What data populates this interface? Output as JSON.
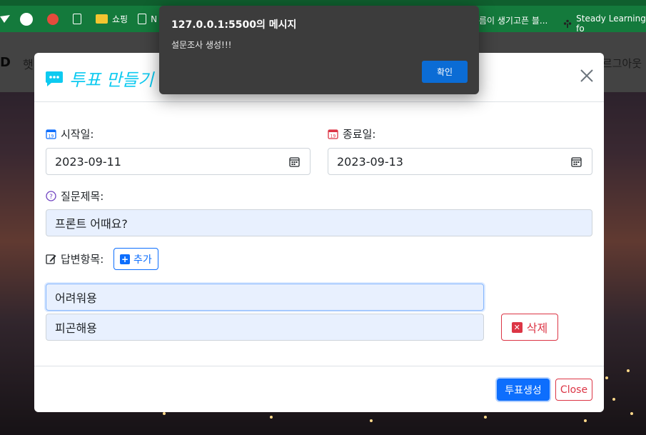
{
  "browser": {
    "bookmarks": [
      {
        "icon": "github-icon",
        "label": ""
      },
      {
        "icon": "red-circle-icon",
        "label": ""
      },
      {
        "icon": "doc-icon",
        "label": ""
      },
      {
        "icon": "folder-icon",
        "label": "쇼핑"
      },
      {
        "icon": "doc-icon",
        "label": "N"
      }
    ],
    "bookmark_right_1": "름이 생기고픈 블...",
    "bookmark_right_2": "Steady Learning fo"
  },
  "site": {
    "logo": "D",
    "nav_left": "햇",
    "nav_right": "르그아웃"
  },
  "alert": {
    "title": "127.0.0.1:5500의 메시지",
    "message": "설문조사 생성!!!",
    "ok_label": "확인"
  },
  "modal": {
    "title": "투표 만들기",
    "start_label": "시작일:",
    "start_value": "2023-09-11",
    "end_label": "종료일:",
    "end_value": "2023-09-13",
    "question_label": "질문제목:",
    "question_value": "프론트 어때요?",
    "answers_label": "답변항목:",
    "add_label": "추가",
    "answers": [
      "어려워용",
      "피곤해용"
    ],
    "delete_label": "삭제",
    "submit_label": "투표생성",
    "close_label": "Close"
  },
  "colors": {
    "accent": "#0dcaf0",
    "primary": "#0d6efd",
    "danger": "#dc3545",
    "bookmark_bar": "#147a3c"
  }
}
